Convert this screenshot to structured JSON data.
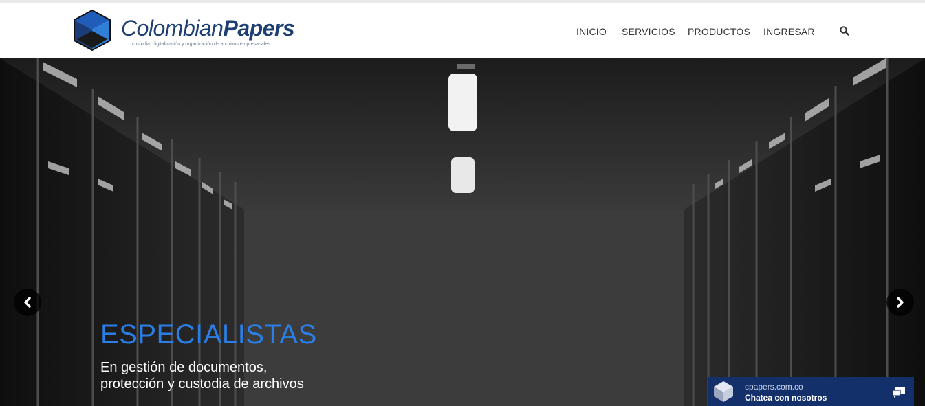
{
  "brand": {
    "name_light": "Colombian",
    "name_bold": "Papers",
    "tagline": "custodia, digitalización y organización de archivos empresariales",
    "logo_icon": "cube-logo-icon",
    "color": "#1d3f73"
  },
  "nav": {
    "items": [
      {
        "label": "INICIO"
      },
      {
        "label": "SERVICIOS"
      },
      {
        "label": "PRODUCTOS"
      },
      {
        "label": "INGRESAR"
      }
    ],
    "search_icon": "search-icon"
  },
  "hero": {
    "title": "ESPECIALISTAS",
    "subtitle_line1": "En gestión de documentos,",
    "subtitle_line2": "protección y custodia de archivos",
    "title_color": "#2a7ee6",
    "prev_icon": "chevron-left-icon",
    "next_icon": "chevron-right-icon"
  },
  "chat": {
    "domain": "cpapers.com.co",
    "label": "Chatea con nosotros",
    "icon": "chat-bubbles-icon",
    "background": "#14306b"
  }
}
